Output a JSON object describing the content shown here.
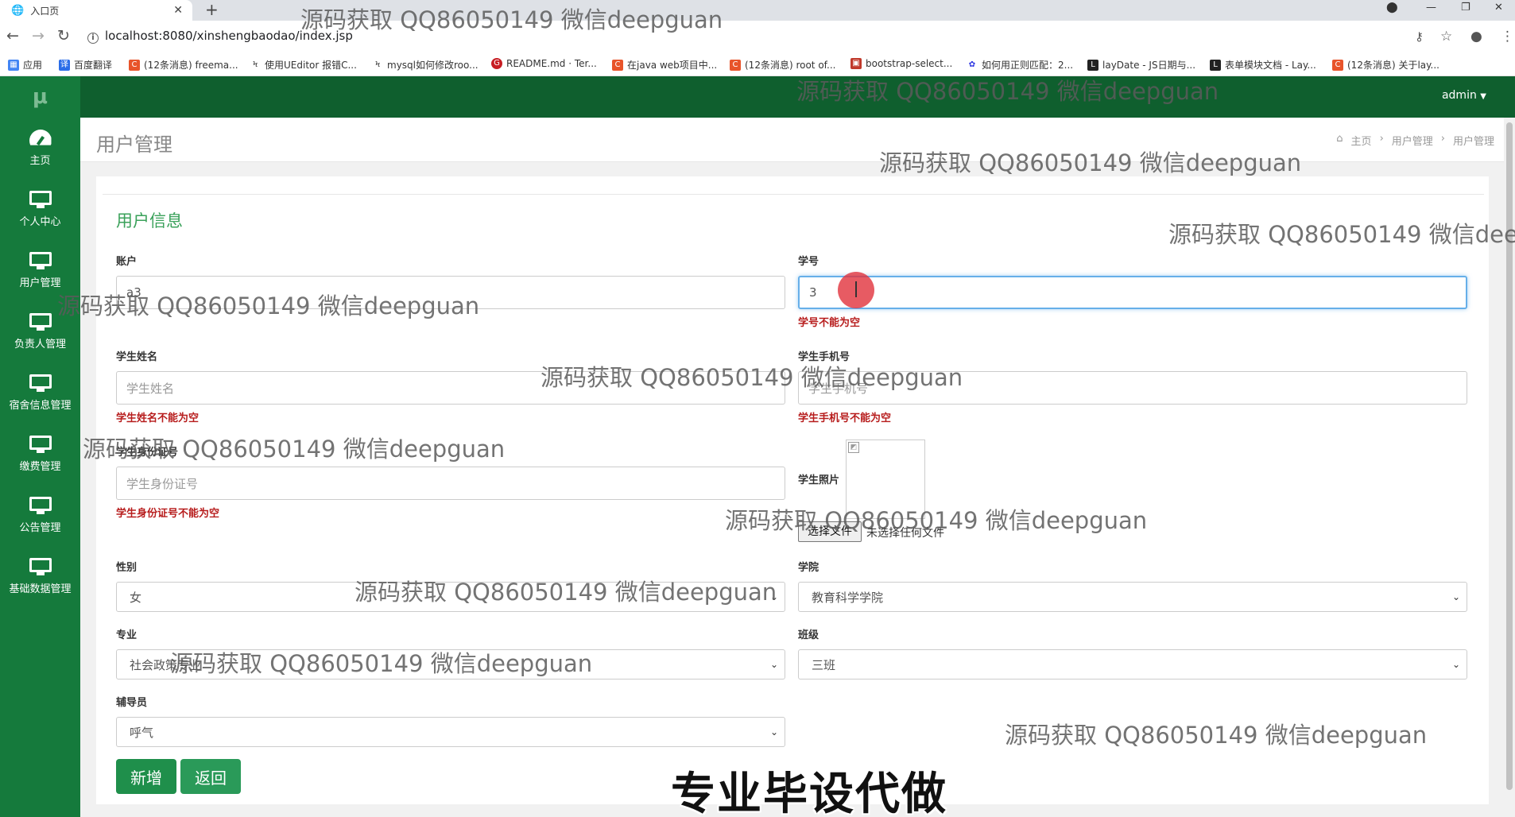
{
  "browser": {
    "tab_title": "入口页",
    "url": "localhost:8080/xinshengbaodao/index.jsp",
    "bookmarks": [
      "应用",
      "百度翻译",
      "(12条消息) freema...",
      "使用UEditor 报错C...",
      "mysql如何修改roo...",
      "README.md · Ter...",
      "在java web项目中...",
      "(12条消息) root of...",
      "bootstrap-select...",
      "如何用正则匹配：2...",
      "layDate - JS日期与...",
      "表单模块文档 - Lay...",
      "(12条消息) 关于lay..."
    ]
  },
  "app": {
    "logo": "μ",
    "user_menu": "admin",
    "nav": [
      "主页",
      "个人中心",
      "用户管理",
      "负责人管理",
      "宿舍信息管理",
      "缴费管理",
      "公告管理",
      "基础数据管理"
    ]
  },
  "header": {
    "title": "用户管理",
    "breadcrumb": [
      "主页",
      "用户管理",
      "用户管理"
    ]
  },
  "form": {
    "section_title": "用户信息",
    "account": {
      "label": "账户",
      "value": "a3"
    },
    "student_no": {
      "label": "学号",
      "value": "3",
      "error": "学号不能为空"
    },
    "student_name": {
      "label": "学生姓名",
      "placeholder": "学生姓名",
      "error": "学生姓名不能为空"
    },
    "student_phone": {
      "label": "学生手机号",
      "placeholder": "学生手机号",
      "error": "学生手机号不能为空"
    },
    "student_id_card": {
      "label": "学生身份证号",
      "placeholder": "学生身份证号",
      "error": "学生身份证号不能为空"
    },
    "student_photo": {
      "label": "学生照片",
      "choose_button": "选择文件",
      "no_file": "未选择任何文件"
    },
    "gender": {
      "label": "性别",
      "value": "女"
    },
    "college": {
      "label": "学院",
      "value": "教育科学学院"
    },
    "major": {
      "label": "专业",
      "value": "社会政策专业"
    },
    "class": {
      "label": "班级",
      "value": "三班"
    },
    "counselor": {
      "label": "辅导员",
      "value": "呼气"
    },
    "add_button": "新增",
    "back_button": "返回"
  },
  "overlay": {
    "watermark": "源码获取 QQ86050149 微信deepguan",
    "watermark_cut": "源码获取 QQ86050149 微信dee",
    "banner": "专业毕设代做"
  },
  "colors": {
    "sidebar": "#157a3c",
    "topbar": "#0f5f2e",
    "accent": "#3aa15a",
    "error": "#b71c1c"
  }
}
